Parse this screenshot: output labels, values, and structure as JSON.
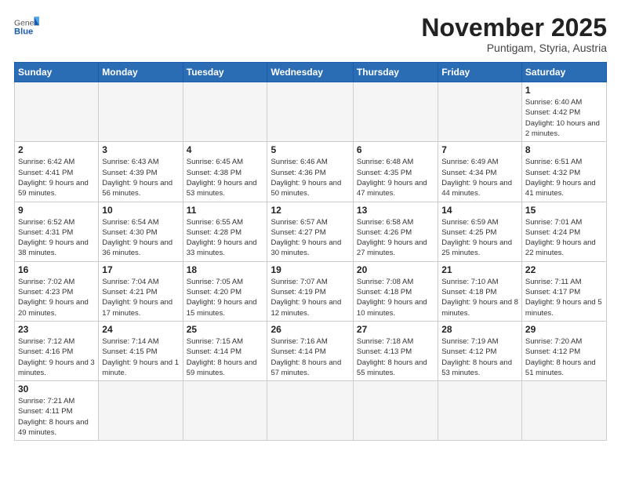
{
  "logo": {
    "general": "General",
    "blue": "Blue"
  },
  "title": "November 2025",
  "subtitle": "Puntigam, Styria, Austria",
  "days_of_week": [
    "Sunday",
    "Monday",
    "Tuesday",
    "Wednesday",
    "Thursday",
    "Friday",
    "Saturday"
  ],
  "weeks": [
    [
      {
        "day": "",
        "info": ""
      },
      {
        "day": "",
        "info": ""
      },
      {
        "day": "",
        "info": ""
      },
      {
        "day": "",
        "info": ""
      },
      {
        "day": "",
        "info": ""
      },
      {
        "day": "",
        "info": ""
      },
      {
        "day": "1",
        "info": "Sunrise: 6:40 AM\nSunset: 4:42 PM\nDaylight: 10 hours and 2 minutes."
      }
    ],
    [
      {
        "day": "2",
        "info": "Sunrise: 6:42 AM\nSunset: 4:41 PM\nDaylight: 9 hours and 59 minutes."
      },
      {
        "day": "3",
        "info": "Sunrise: 6:43 AM\nSunset: 4:39 PM\nDaylight: 9 hours and 56 minutes."
      },
      {
        "day": "4",
        "info": "Sunrise: 6:45 AM\nSunset: 4:38 PM\nDaylight: 9 hours and 53 minutes."
      },
      {
        "day": "5",
        "info": "Sunrise: 6:46 AM\nSunset: 4:36 PM\nDaylight: 9 hours and 50 minutes."
      },
      {
        "day": "6",
        "info": "Sunrise: 6:48 AM\nSunset: 4:35 PM\nDaylight: 9 hours and 47 minutes."
      },
      {
        "day": "7",
        "info": "Sunrise: 6:49 AM\nSunset: 4:34 PM\nDaylight: 9 hours and 44 minutes."
      },
      {
        "day": "8",
        "info": "Sunrise: 6:51 AM\nSunset: 4:32 PM\nDaylight: 9 hours and 41 minutes."
      }
    ],
    [
      {
        "day": "9",
        "info": "Sunrise: 6:52 AM\nSunset: 4:31 PM\nDaylight: 9 hours and 38 minutes."
      },
      {
        "day": "10",
        "info": "Sunrise: 6:54 AM\nSunset: 4:30 PM\nDaylight: 9 hours and 36 minutes."
      },
      {
        "day": "11",
        "info": "Sunrise: 6:55 AM\nSunset: 4:28 PM\nDaylight: 9 hours and 33 minutes."
      },
      {
        "day": "12",
        "info": "Sunrise: 6:57 AM\nSunset: 4:27 PM\nDaylight: 9 hours and 30 minutes."
      },
      {
        "day": "13",
        "info": "Sunrise: 6:58 AM\nSunset: 4:26 PM\nDaylight: 9 hours and 27 minutes."
      },
      {
        "day": "14",
        "info": "Sunrise: 6:59 AM\nSunset: 4:25 PM\nDaylight: 9 hours and 25 minutes."
      },
      {
        "day": "15",
        "info": "Sunrise: 7:01 AM\nSunset: 4:24 PM\nDaylight: 9 hours and 22 minutes."
      }
    ],
    [
      {
        "day": "16",
        "info": "Sunrise: 7:02 AM\nSunset: 4:23 PM\nDaylight: 9 hours and 20 minutes."
      },
      {
        "day": "17",
        "info": "Sunrise: 7:04 AM\nSunset: 4:21 PM\nDaylight: 9 hours and 17 minutes."
      },
      {
        "day": "18",
        "info": "Sunrise: 7:05 AM\nSunset: 4:20 PM\nDaylight: 9 hours and 15 minutes."
      },
      {
        "day": "19",
        "info": "Sunrise: 7:07 AM\nSunset: 4:19 PM\nDaylight: 9 hours and 12 minutes."
      },
      {
        "day": "20",
        "info": "Sunrise: 7:08 AM\nSunset: 4:18 PM\nDaylight: 9 hours and 10 minutes."
      },
      {
        "day": "21",
        "info": "Sunrise: 7:10 AM\nSunset: 4:18 PM\nDaylight: 9 hours and 8 minutes."
      },
      {
        "day": "22",
        "info": "Sunrise: 7:11 AM\nSunset: 4:17 PM\nDaylight: 9 hours and 5 minutes."
      }
    ],
    [
      {
        "day": "23",
        "info": "Sunrise: 7:12 AM\nSunset: 4:16 PM\nDaylight: 9 hours and 3 minutes."
      },
      {
        "day": "24",
        "info": "Sunrise: 7:14 AM\nSunset: 4:15 PM\nDaylight: 9 hours and 1 minute."
      },
      {
        "day": "25",
        "info": "Sunrise: 7:15 AM\nSunset: 4:14 PM\nDaylight: 8 hours and 59 minutes."
      },
      {
        "day": "26",
        "info": "Sunrise: 7:16 AM\nSunset: 4:14 PM\nDaylight: 8 hours and 57 minutes."
      },
      {
        "day": "27",
        "info": "Sunrise: 7:18 AM\nSunset: 4:13 PM\nDaylight: 8 hours and 55 minutes."
      },
      {
        "day": "28",
        "info": "Sunrise: 7:19 AM\nSunset: 4:12 PM\nDaylight: 8 hours and 53 minutes."
      },
      {
        "day": "29",
        "info": "Sunrise: 7:20 AM\nSunset: 4:12 PM\nDaylight: 8 hours and 51 minutes."
      }
    ],
    [
      {
        "day": "30",
        "info": "Sunrise: 7:21 AM\nSunset: 4:11 PM\nDaylight: 8 hours and 49 minutes."
      },
      {
        "day": "",
        "info": ""
      },
      {
        "day": "",
        "info": ""
      },
      {
        "day": "",
        "info": ""
      },
      {
        "day": "",
        "info": ""
      },
      {
        "day": "",
        "info": ""
      },
      {
        "day": "",
        "info": ""
      }
    ]
  ]
}
